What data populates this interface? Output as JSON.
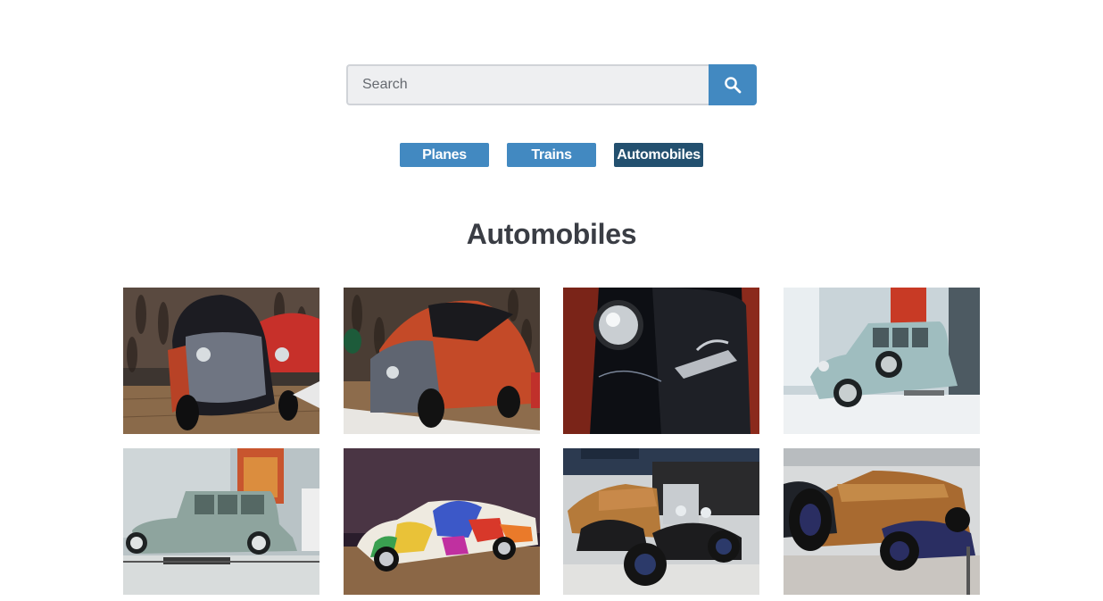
{
  "search": {
    "placeholder": "Search",
    "value": "",
    "button_icon": "search-icon"
  },
  "categories": [
    {
      "label": "Planes",
      "active": false
    },
    {
      "label": "Trains",
      "active": false
    },
    {
      "label": "Automobiles",
      "active": true
    }
  ],
  "heading": "Automobiles",
  "gallery": [
    {
      "subject": "vintage black and red micro car, front view"
    },
    {
      "subject": "vintage black and red micro car, side view"
    },
    {
      "subject": "headlight and Standard emblem close-up"
    },
    {
      "subject": "light blue vintage sedan"
    },
    {
      "subject": "grey-green vintage limousine"
    },
    {
      "subject": "art car with colorful painted figures"
    },
    {
      "subject": "wooden-bodied vintage roadster with black fenders"
    },
    {
      "subject": "wooden-bodied vintage roadster, rear view"
    }
  ],
  "colors": {
    "accent": "#4289c1",
    "active": "#23506f",
    "heading": "#3a3d44"
  }
}
